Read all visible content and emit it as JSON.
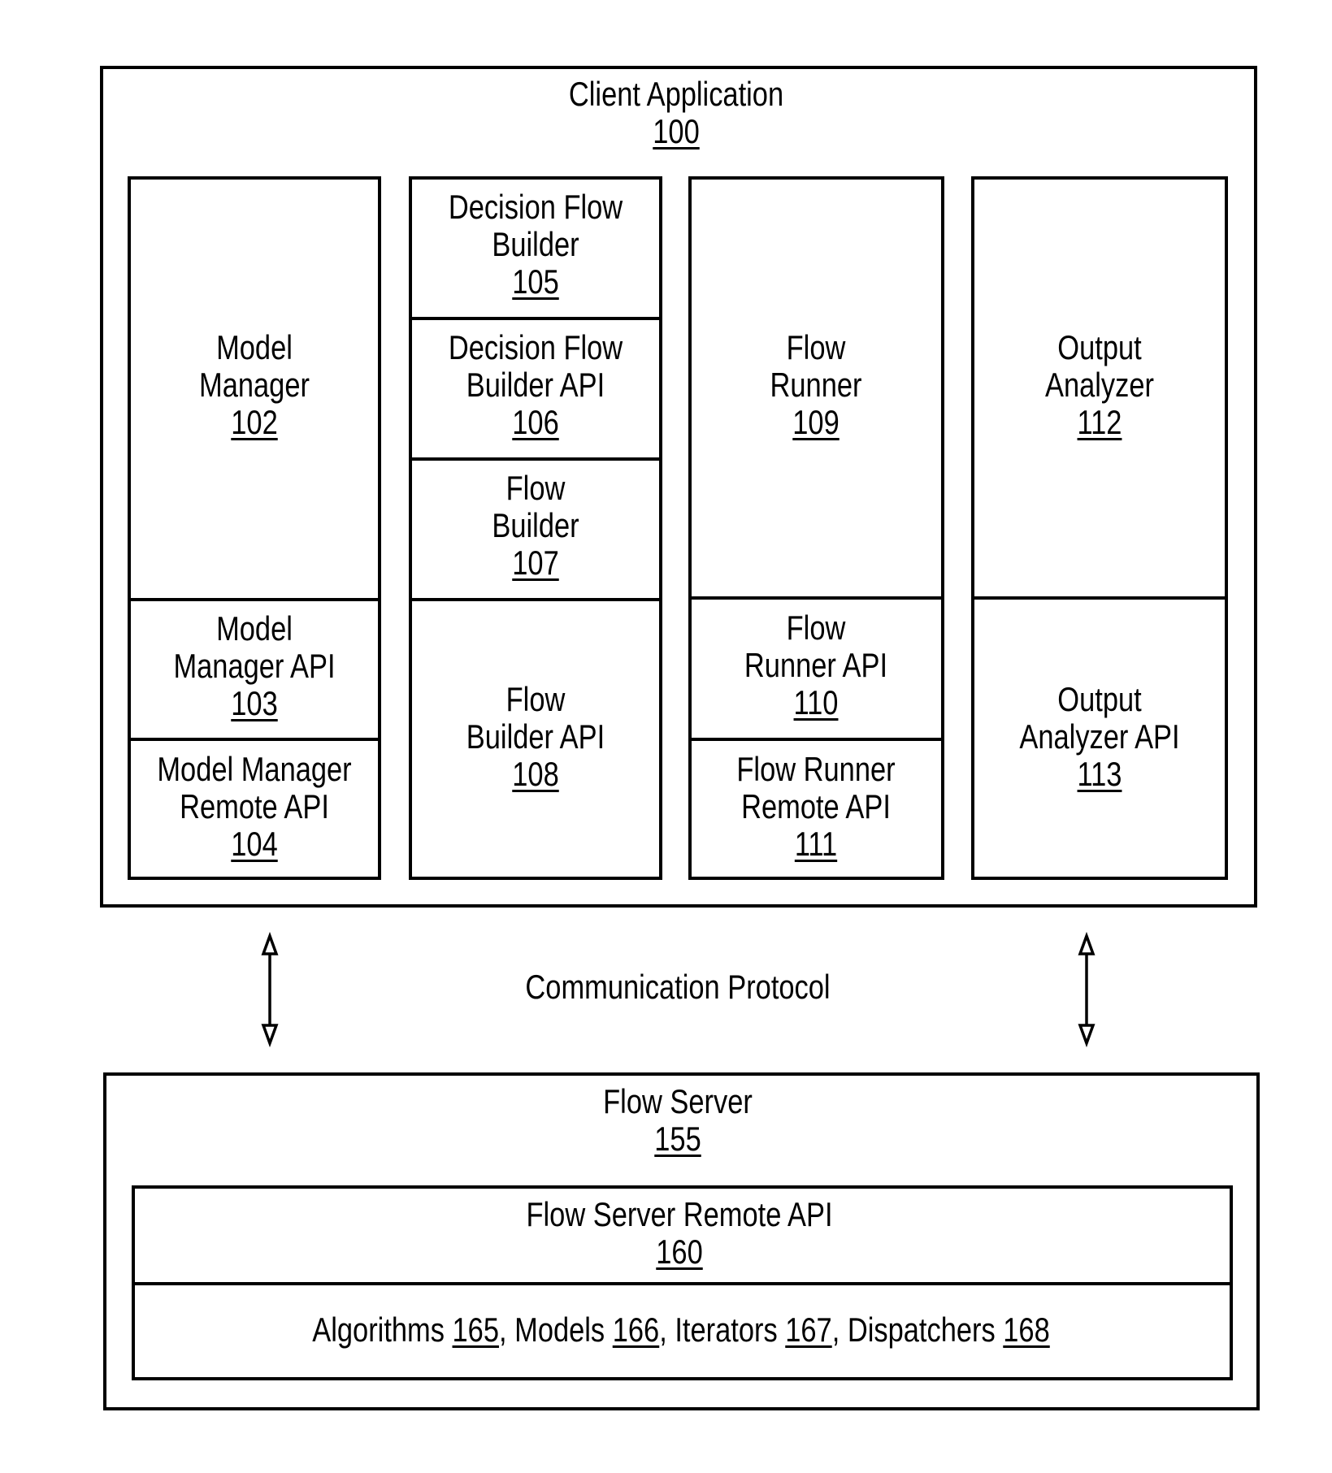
{
  "client_application": {
    "title": "Client Application",
    "ref": "100",
    "columns": [
      {
        "cells": [
          {
            "lines": [
              "Model",
              "Manager"
            ],
            "ref": "102"
          },
          {
            "lines": [
              "Model",
              "Manager API"
            ],
            "ref": "103"
          },
          {
            "lines": [
              "Model Manager",
              "Remote API"
            ],
            "ref": "104"
          }
        ]
      },
      {
        "cells": [
          {
            "lines": [
              "Decision Flow",
              "Builder"
            ],
            "ref": "105"
          },
          {
            "lines": [
              "Decision Flow",
              "Builder API"
            ],
            "ref": "106"
          },
          {
            "lines": [
              "Flow",
              "Builder"
            ],
            "ref": "107"
          },
          {
            "lines": [
              "Flow",
              "Builder API"
            ],
            "ref": "108"
          }
        ]
      },
      {
        "cells": [
          {
            "lines": [
              "Flow",
              "Runner"
            ],
            "ref": "109"
          },
          {
            "lines": [
              "Flow",
              "Runner API"
            ],
            "ref": "110"
          },
          {
            "lines": [
              "Flow Runner",
              "Remote API"
            ],
            "ref": "111"
          }
        ]
      },
      {
        "cells": [
          {
            "lines": [
              "Output",
              "Analyzer"
            ],
            "ref": "112"
          },
          {
            "lines": [
              "Output",
              "Analyzer API"
            ],
            "ref": "113"
          }
        ]
      }
    ]
  },
  "communication": {
    "label": "Communication Protocol",
    "arrows": [
      "bidirectional-arrow-left",
      "bidirectional-arrow-right"
    ]
  },
  "flow_server": {
    "title": "Flow Server",
    "ref": "155",
    "remote_api": {
      "label": "Flow Server Remote API",
      "ref": "160"
    },
    "components": [
      {
        "label": "Algorithms",
        "ref": "165"
      },
      {
        "label": "Models",
        "ref": "166"
      },
      {
        "label": "Iterators",
        "ref": "167"
      },
      {
        "label": "Dispatchers",
        "ref": "168"
      }
    ]
  }
}
